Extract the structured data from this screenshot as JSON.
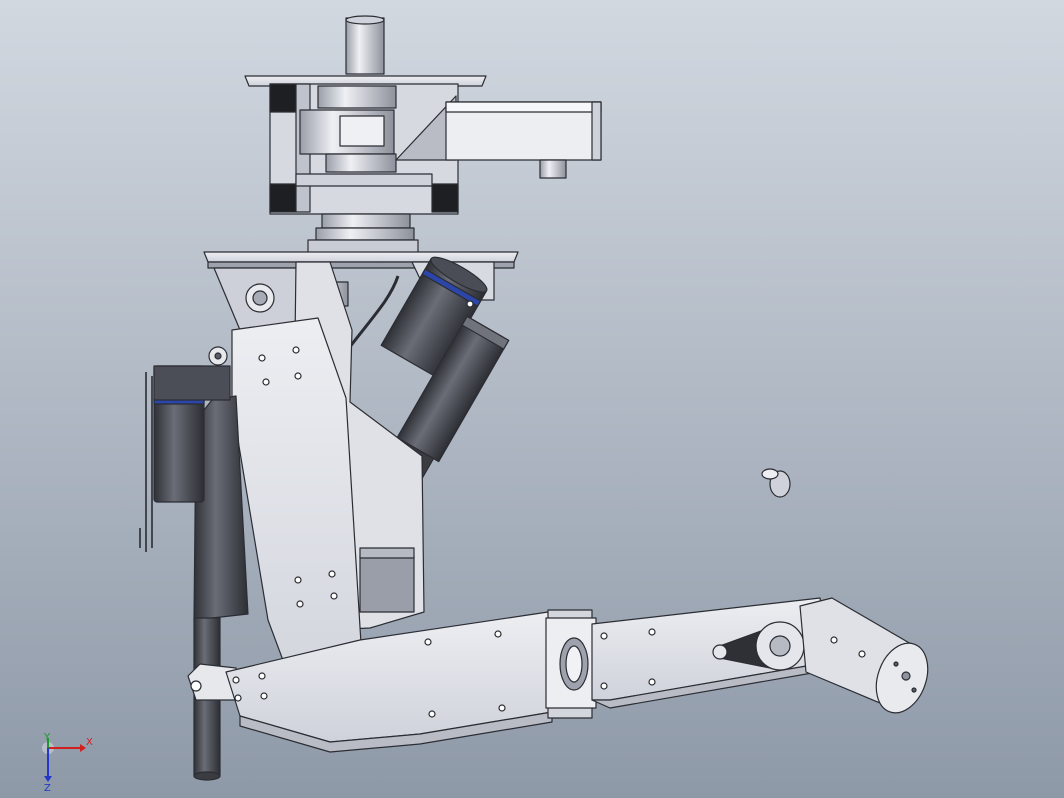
{
  "viewport": {
    "background_top": "#d2d8e0",
    "background_bottom": "#8e99a8"
  },
  "colors": {
    "metal_light": "#e4e6ec",
    "metal_mid": "#c7cad3",
    "metal_dark": "#8f939e",
    "outline": "#2b2d33",
    "motor_dark": "#3b3d44",
    "motor_mid": "#5b5e66",
    "accent_blue": "#2b45a8",
    "axis_x": "#d21f1f",
    "axis_y": "#1a9a2a",
    "axis_z": "#2338c8"
  },
  "triad": {
    "x_label": "X",
    "y_label": "Y",
    "z_label": "Z"
  }
}
